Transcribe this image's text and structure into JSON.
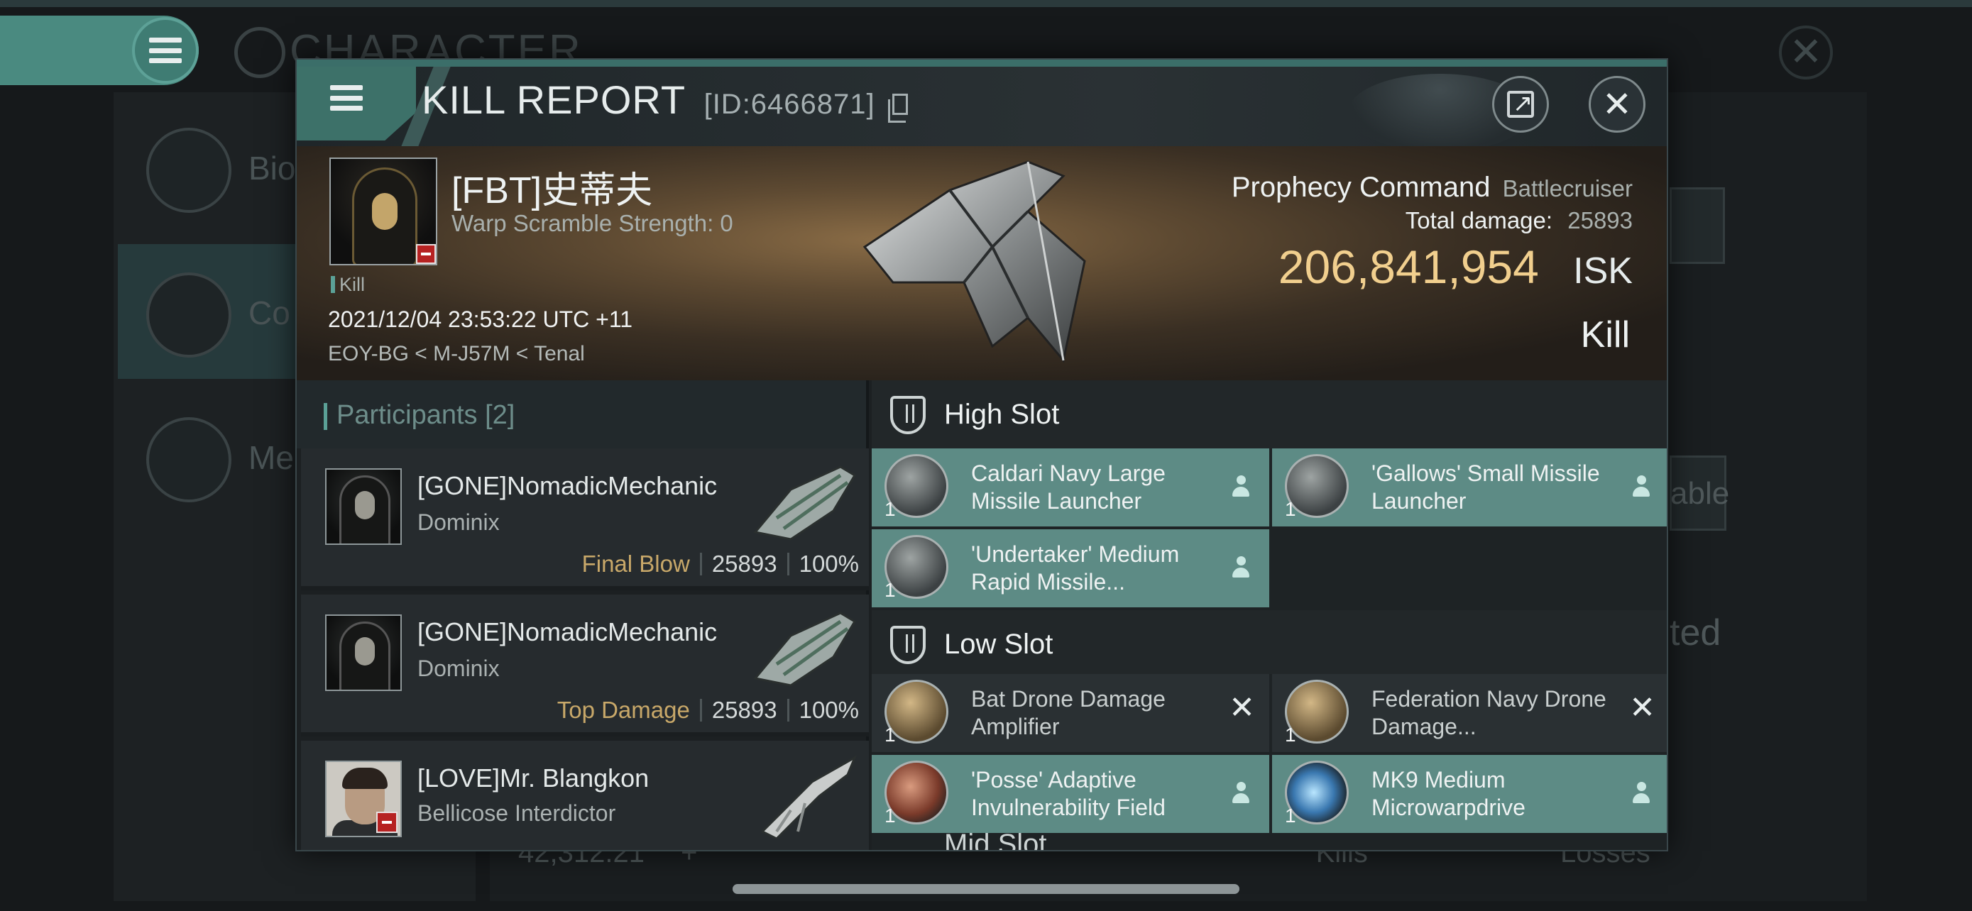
{
  "background": {
    "section_title": "CHARACTER",
    "side_items": [
      "Bio",
      "Co",
      "Me"
    ],
    "right_fragments": [
      "able",
      "ted"
    ],
    "bottom_value": "42,312.21",
    "bottom_plus": "+",
    "bottom_kills": "Kills",
    "bottom_losses": "Losses"
  },
  "modal": {
    "title": "KILL REPORT",
    "kill_id": "[ID:6466871]"
  },
  "victim": {
    "name": "[FBT]史蒂夫",
    "warp": "Warp Scramble Strength: 0",
    "tag": "Kill",
    "datetime": "2021/12/04 23:53:22 UTC +11",
    "location": "EOY-BG < M-J57M < Tenal",
    "ship": "Prophecy Command",
    "ship_class": "Battlecruiser",
    "total_damage_label": "Total damage:",
    "total_damage": "25893",
    "isk_value": "206,841,954",
    "isk_unit": "ISK",
    "kill_type": "Kill"
  },
  "participants": {
    "header": "Participants [2]",
    "rows": [
      {
        "name": "[GONE]NomadicMechanic",
        "ship": "Dominix",
        "label": "Final Blow",
        "damage": "25893",
        "percent": "100%"
      },
      {
        "name": "[GONE]NomadicMechanic",
        "ship": "Dominix",
        "label": "Top Damage",
        "damage": "25893",
        "percent": "100%"
      },
      {
        "name": "[LOVE]Mr. Blangkon",
        "ship": "Bellicose Interdictor"
      }
    ]
  },
  "fitting": {
    "high_slot": {
      "title": "High Slot",
      "modules": [
        {
          "qty": "1",
          "name": "Caldari Navy Large Missile Launcher",
          "icon": "missile-launcher-icon",
          "status": "dropped"
        },
        {
          "qty": "1",
          "name": "'Gallows' Small Missile Launcher",
          "icon": "missile-launcher-icon",
          "status": "dropped"
        },
        {
          "qty": "1",
          "name": "'Undertaker' Medium Rapid Missile...",
          "icon": "rapid-launcher-icon",
          "status": "dropped"
        }
      ]
    },
    "low_slot": {
      "title": "Low Slot",
      "modules": [
        {
          "qty": "1",
          "name": "Bat Drone Damage Amplifier",
          "icon": "drone-amplifier-icon",
          "status": "destroyed"
        },
        {
          "qty": "1",
          "name": "Federation Navy Drone Damage...",
          "icon": "drone-amplifier-icon",
          "status": "destroyed"
        },
        {
          "qty": "1",
          "name": "'Posse' Adaptive Invulnerability Field",
          "icon": "shield-field-icon",
          "status": "dropped"
        },
        {
          "qty": "1",
          "name": "MK9 Medium Microwarpdrive",
          "icon": "microwarpdrive-icon",
          "status": "dropped"
        }
      ]
    },
    "mid_slot_partial": "Mid Slot"
  }
}
